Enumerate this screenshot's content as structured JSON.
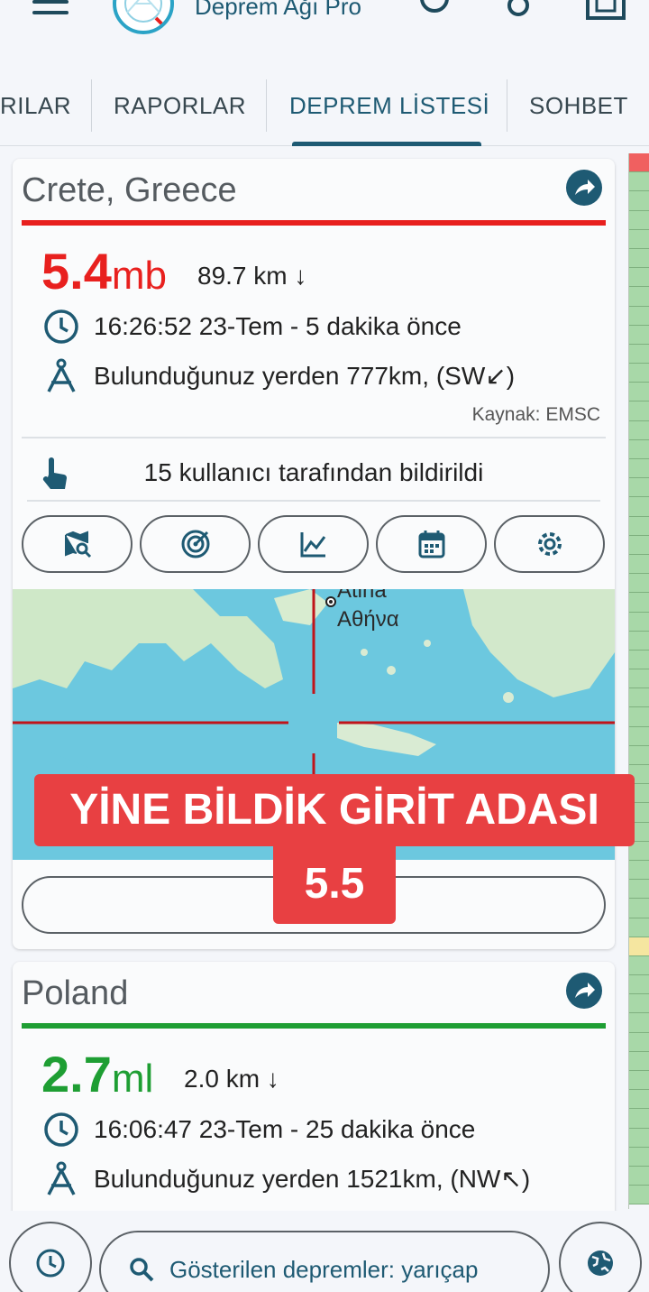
{
  "app": {
    "title": "Deprem Ağı Pro"
  },
  "tabs": [
    {
      "label": "RILAR"
    },
    {
      "label": "RAPORLAR"
    },
    {
      "label": "DEPREM LİSTESİ",
      "active": true
    },
    {
      "label": "SOHBET"
    }
  ],
  "quakes": [
    {
      "location": "Crete, Greece",
      "magnitude": "5.4",
      "mag_type": "mb",
      "depth": "89.7 km ↓",
      "time": "16:26:52 23-Tem - 5 dakika önce",
      "distance": "Bulunduğunuz yerden 777km, (SW↙)",
      "source": "Kaynak: EMSC",
      "reported": "15 kullanıcı tarafından bildirildi",
      "severity_color": "#e8201e",
      "map_labels": [
        "Atina",
        "Αθήνα"
      ]
    },
    {
      "location": "Poland",
      "magnitude": "2.7",
      "mag_type": "ml",
      "depth": "2.0 km ↓",
      "time": "16:06:47 23-Tem - 25 dakika önce",
      "distance": "Bulunduğunuz yerden 1521km, (NW↖)",
      "severity_color": "#1e9e33"
    }
  ],
  "overlay": {
    "line1": "YİNE BİLDİK GİRİT ADASI",
    "line2": "5.5"
  },
  "bottom": {
    "filter_label": "Gösterilen depremler: yarıçap"
  },
  "colors": {
    "accent": "#1e5a73",
    "scale_green": "#a8d8a8",
    "scale_red": "#f06060",
    "scale_yellow": "#f5e6a0",
    "caption_red": "#e84042"
  }
}
